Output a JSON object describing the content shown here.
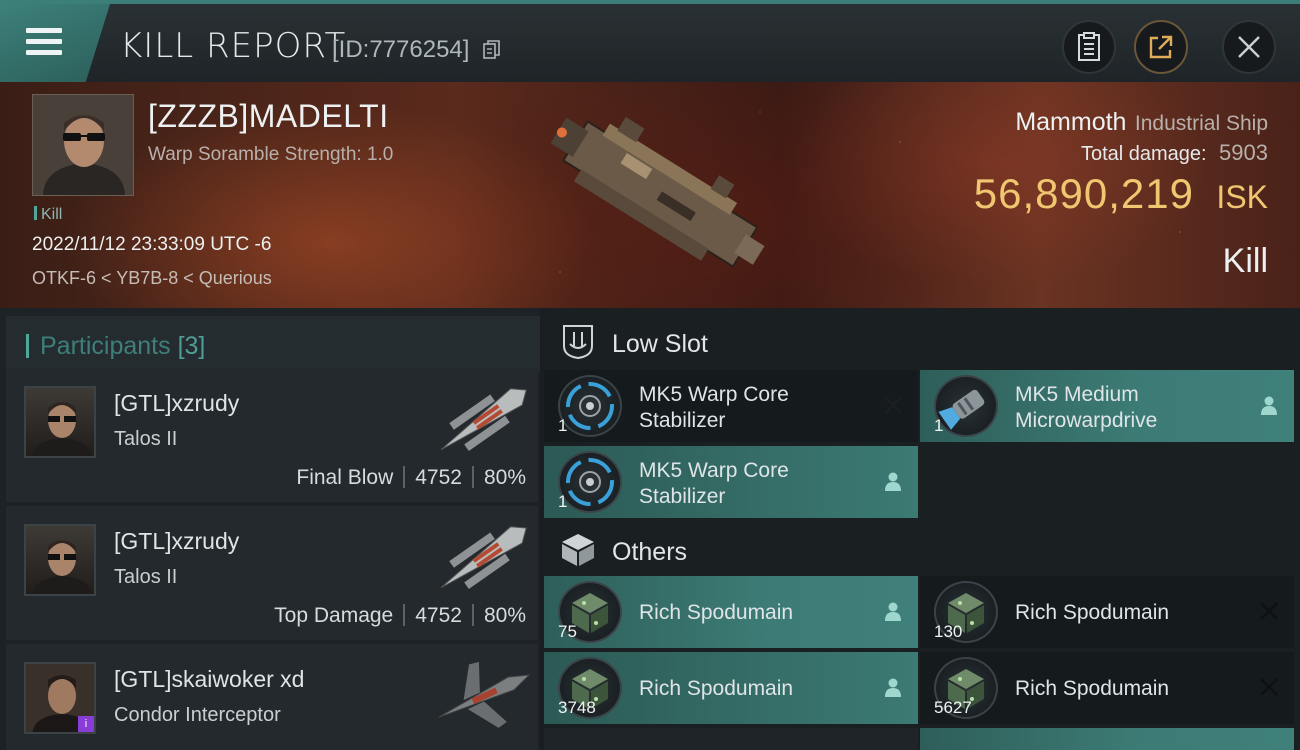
{
  "header": {
    "title": "KILL REPORT",
    "report_id": "[ID:7776254]"
  },
  "victim": {
    "name": "[ZZZB]MADELTI",
    "subtitle": "Warp Soramble Strength: 1.0",
    "tag": "Kill",
    "datetime": "2022/11/12 23:33:09 UTC -6",
    "location": "OTKF-6 < YB7B-8 < Querious",
    "ship_name": "Mammoth",
    "ship_class": "Industrial Ship",
    "total_damage_label": "Total damage:",
    "total_damage": "5903",
    "isk_value": "56,890,219",
    "isk_unit": "ISK",
    "result": "Kill"
  },
  "participants": {
    "title": "Participants",
    "count": "[3]",
    "rows": [
      {
        "name": "[GTL]xzrudy",
        "ship": "Talos II",
        "role": "Final Blow",
        "damage": "4752",
        "percent": "80%"
      },
      {
        "name": "[GTL]xzrudy",
        "ship": "Talos II",
        "role": "Top Damage",
        "damage": "4752",
        "percent": "80%"
      },
      {
        "name": "[GTL]skaiwoker xd",
        "ship": "Condor Interceptor",
        "badge": "i"
      }
    ]
  },
  "low_slot": {
    "title": "Low Slot",
    "items": [
      {
        "name": "MK5 Warp Core Stabilizer",
        "qty": "1",
        "status": "destroyed"
      },
      {
        "name": "MK5 Medium Microwarpdrive",
        "qty": "1",
        "status": "dropped"
      },
      {
        "name": "MK5 Warp Core Stabilizer",
        "qty": "1",
        "status": "dropped"
      }
    ]
  },
  "others": {
    "title": "Others",
    "items": [
      {
        "name": "Rich Spodumain",
        "qty": "75",
        "status": "dropped"
      },
      {
        "name": "Rich Spodumain",
        "qty": "130",
        "status": "destroyed"
      },
      {
        "name": "Rich Spodumain",
        "qty": "3748",
        "status": "dropped"
      },
      {
        "name": "Rich Spodumain",
        "qty": "5627",
        "status": "destroyed"
      }
    ]
  }
}
